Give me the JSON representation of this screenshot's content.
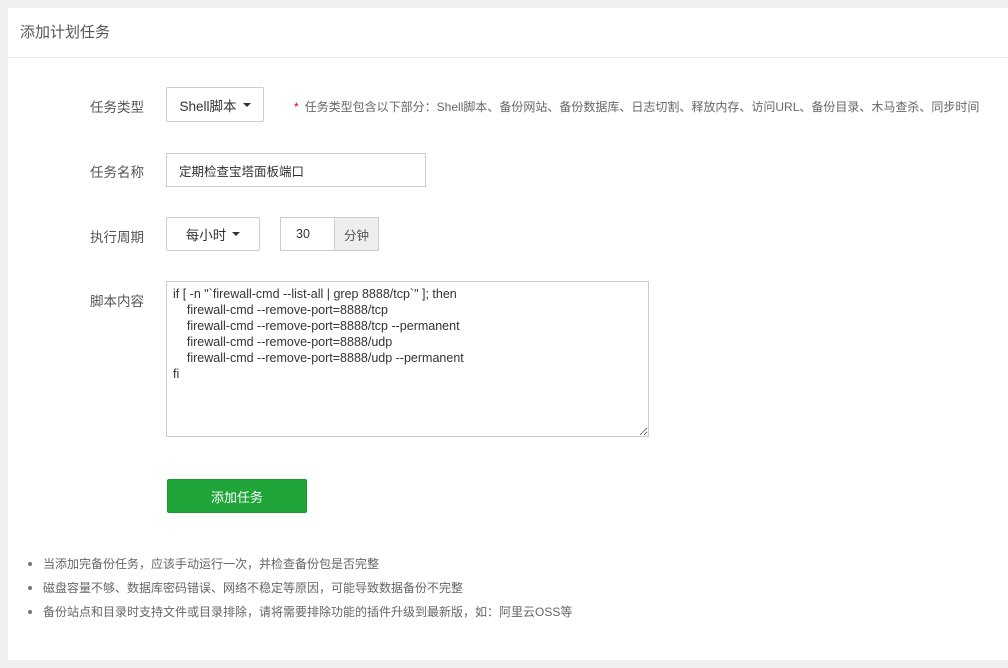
{
  "header": {
    "title": "添加计划任务"
  },
  "form": {
    "task_type": {
      "label": "任务类型",
      "value": "Shell脚本",
      "hint_star": "*",
      "hint": "任务类型包含以下部分：Shell脚本、备份网站、备份数据库、日志切割、释放内存、访问URL、备份目录、木马查杀、同步时间"
    },
    "task_name": {
      "label": "任务名称",
      "value": "定期检查宝塔面板端口"
    },
    "cycle": {
      "label": "执行周期",
      "period": "每小时",
      "minutes": "30",
      "unit": "分钟"
    },
    "script": {
      "label": "脚本内容",
      "value": "if [ -n \"`firewall-cmd --list-all | grep 8888/tcp`\" ]; then\n    firewall-cmd --remove-port=8888/tcp\n    firewall-cmd --remove-port=8888/tcp --permanent\n    firewall-cmd --remove-port=8888/udp\n    firewall-cmd --remove-port=8888/udp --permanent\nfi"
    },
    "submit_label": "添加任务"
  },
  "notes": [
    "当添加完备份任务，应该手动运行一次，并检查备份包是否完整",
    "磁盘容量不够、数据库密码错误、网络不稳定等原因，可能导致数据备份不完整",
    "备份站点和目录时支持文件或目录排除，请将需要排除功能的插件升级到最新版，如：阿里云OSS等"
  ]
}
